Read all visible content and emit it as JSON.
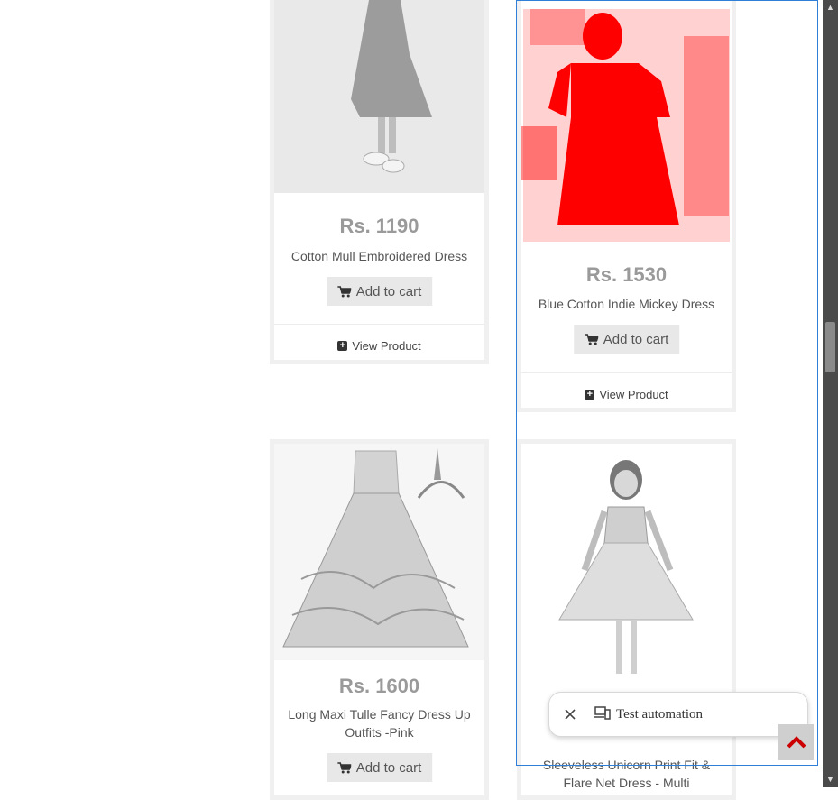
{
  "products": [
    {
      "price": "Rs. 1190",
      "name": "Cotton Mull Embroidered Dress",
      "add_to_cart": "Add to cart",
      "view_product": "View Product"
    },
    {
      "price": "Rs. 1530",
      "name": "Blue Cotton Indie Mickey Dress",
      "add_to_cart": "Add to cart",
      "view_product": "View Product"
    },
    {
      "price": "Rs. 1600",
      "name": "Long Maxi Tulle Fancy Dress Up Outfits -Pink",
      "add_to_cart": "Add to cart"
    },
    {
      "name": "Sleeveless Unicorn Print Fit & Flare Net Dress - Multi"
    }
  ],
  "automation_bar": {
    "label": "Test automation"
  },
  "colors": {
    "highlight_border": "#2f7fd8",
    "highlight_fill": "#ff0000",
    "scroll_top_arrow": "#cc0000"
  }
}
